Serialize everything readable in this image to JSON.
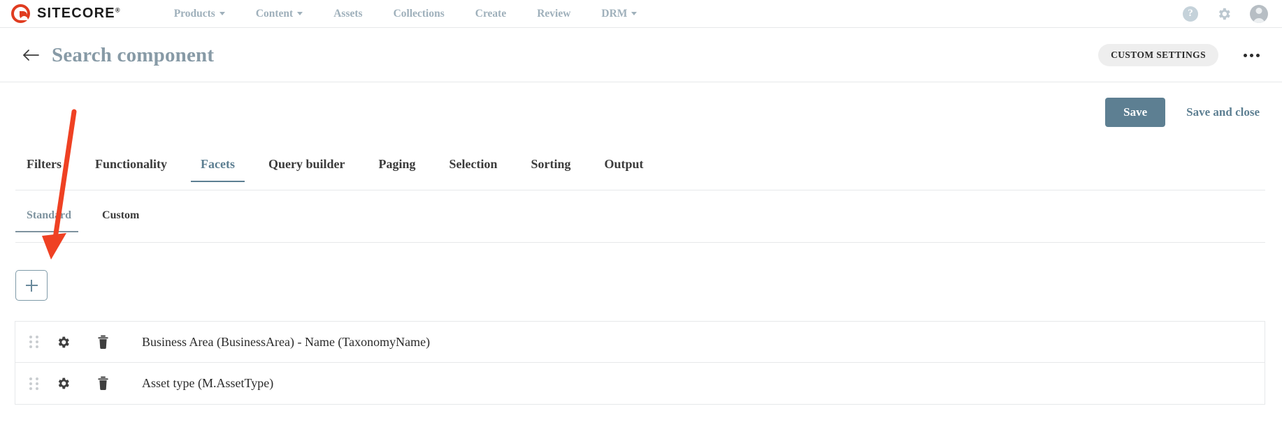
{
  "topnav": {
    "brand": {
      "name": "SITECORE",
      "trademark": "®",
      "logo_icon": "sitecore-logo-icon",
      "logo_color": "#e03c20"
    },
    "links": [
      {
        "label": "Products",
        "has_caret": true
      },
      {
        "label": "Content",
        "has_caret": true
      },
      {
        "label": "Assets",
        "has_caret": false
      },
      {
        "label": "Collections",
        "has_caret": false
      },
      {
        "label": "Create",
        "has_caret": false
      },
      {
        "label": "Review",
        "has_caret": false
      },
      {
        "label": "DRM",
        "has_caret": true
      }
    ],
    "link_color": "#9fb0bb",
    "right_icons": [
      {
        "name": "help-icon",
        "glyph": "?"
      },
      {
        "name": "gear-icon",
        "glyph": "gear"
      },
      {
        "name": "user-avatar-icon",
        "glyph": "avatar"
      }
    ]
  },
  "titlebar": {
    "back_icon": "back-arrow-icon",
    "title": "Search component",
    "title_color": "#879aa6",
    "custom_settings_label": "CUSTOM SETTINGS",
    "overflow_icon": "ellipsis-icon"
  },
  "actions": {
    "save_label": "Save",
    "save_and_close_label": "Save and close",
    "accent_color": "#5d7f92"
  },
  "tabs": {
    "items": [
      {
        "label": "Filters",
        "active": false
      },
      {
        "label": "Functionality",
        "active": false
      },
      {
        "label": "Facets",
        "active": true
      },
      {
        "label": "Query builder",
        "active": false
      },
      {
        "label": "Paging",
        "active": false
      },
      {
        "label": "Selection",
        "active": false
      },
      {
        "label": "Sorting",
        "active": false
      },
      {
        "label": "Output",
        "active": false
      }
    ]
  },
  "subtabs": {
    "items": [
      {
        "label": "Standard",
        "active": true
      },
      {
        "label": "Custom",
        "active": false
      }
    ]
  },
  "add_button": {
    "icon": "plus-icon",
    "border_color": "#7f9aa8"
  },
  "facet_list": {
    "rows": [
      {
        "drag_icon": "drag-handle-icon",
        "settings_icon": "gear-icon",
        "delete_icon": "trash-icon",
        "label": "Business Area (BusinessArea) - Name (TaxonomyName)"
      },
      {
        "drag_icon": "drag-handle-icon",
        "settings_icon": "gear-icon",
        "delete_icon": "trash-icon",
        "label": "Asset type (M.AssetType)"
      }
    ]
  },
  "annotation": {
    "type": "arrow",
    "color": "#ef4123",
    "points_to": "add-facet-button"
  }
}
